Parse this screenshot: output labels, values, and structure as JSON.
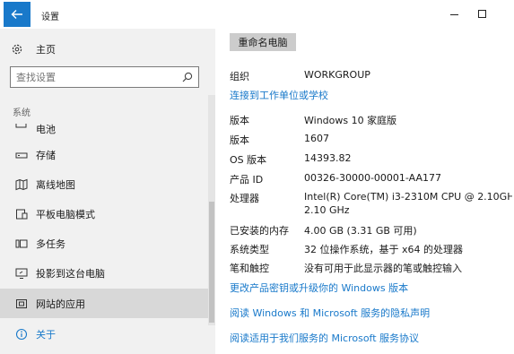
{
  "window": {
    "title": "设置",
    "controls": [
      "minimize-icon",
      "maximize-icon"
    ],
    "back_icon": "arrow-left-icon"
  },
  "colors": {
    "accent": "#1979ca",
    "sidebar_bg": "#f1f1f1",
    "selected_bg": "#d8d8d8",
    "button_bg": "#cccccc"
  },
  "sidebar": {
    "home": {
      "icon": "gear-icon",
      "label": "主页"
    },
    "search": {
      "placeholder": "查找设置",
      "icon": "search-icon"
    },
    "section": "系统",
    "items": [
      {
        "icon": "battery-icon",
        "label": "电池"
      },
      {
        "icon": "storage-icon",
        "label": "存储"
      },
      {
        "icon": "map-icon",
        "label": "离线地图"
      },
      {
        "icon": "tablet-icon",
        "label": "平板电脑模式"
      },
      {
        "icon": "multitask-icon",
        "label": "多任务"
      },
      {
        "icon": "project-icon",
        "label": "投影到这台电脑"
      },
      {
        "icon": "web-app-icon",
        "label": "网站的应用",
        "selected": true
      },
      {
        "icon": "info-icon",
        "label": "关于",
        "active": true
      }
    ]
  },
  "main": {
    "rename_button": "重命名电脑",
    "org": {
      "label": "组织",
      "value": "WORKGROUP"
    },
    "link_work": "连接到工作单位或学校",
    "specs": [
      {
        "label": "版本",
        "value": "Windows 10 家庭版"
      },
      {
        "label": "版本",
        "value": "1607"
      },
      {
        "label": "OS 版本",
        "value": "14393.82"
      },
      {
        "label": "产品 ID",
        "value": "00326-30000-00001-AA177"
      },
      {
        "label": "处理器",
        "value": "Intel(R) Core(TM) i3-2310M CPU @ 2.10GH",
        "value2": "2.10 GHz"
      },
      {
        "label": "已安装的内存",
        "value": "4.00 GB (3.31 GB 可用)"
      },
      {
        "label": "系统类型",
        "value": "32 位操作系统，基于 x64 的处理器"
      },
      {
        "label": "笔和触控",
        "value": "没有可用于此显示器的笔或触控输入"
      }
    ],
    "links": [
      "更改产品密钥或升级你的 Windows 版本",
      "阅读 Windows 和 Microsoft 服务的隐私声明",
      "阅读适用于我们服务的 Microsoft 服务协议"
    ]
  }
}
